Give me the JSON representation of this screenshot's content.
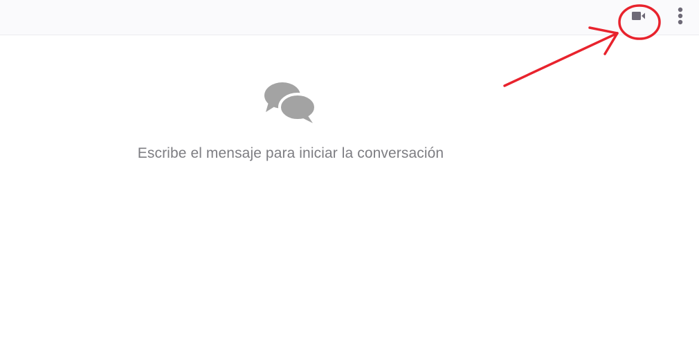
{
  "header": {
    "video_call_icon": "video-camera-icon",
    "more_options_icon": "vertical-dots-icon",
    "icon_color": "#6e6a77"
  },
  "empty_state": {
    "icon": "chat-bubbles-icon",
    "icon_color": "#a3a3a3",
    "message": "Escribe el mensaje para iniciar la conversación"
  },
  "annotation": {
    "color": "#e8232d",
    "shapes": [
      "arrow",
      "circle"
    ]
  }
}
